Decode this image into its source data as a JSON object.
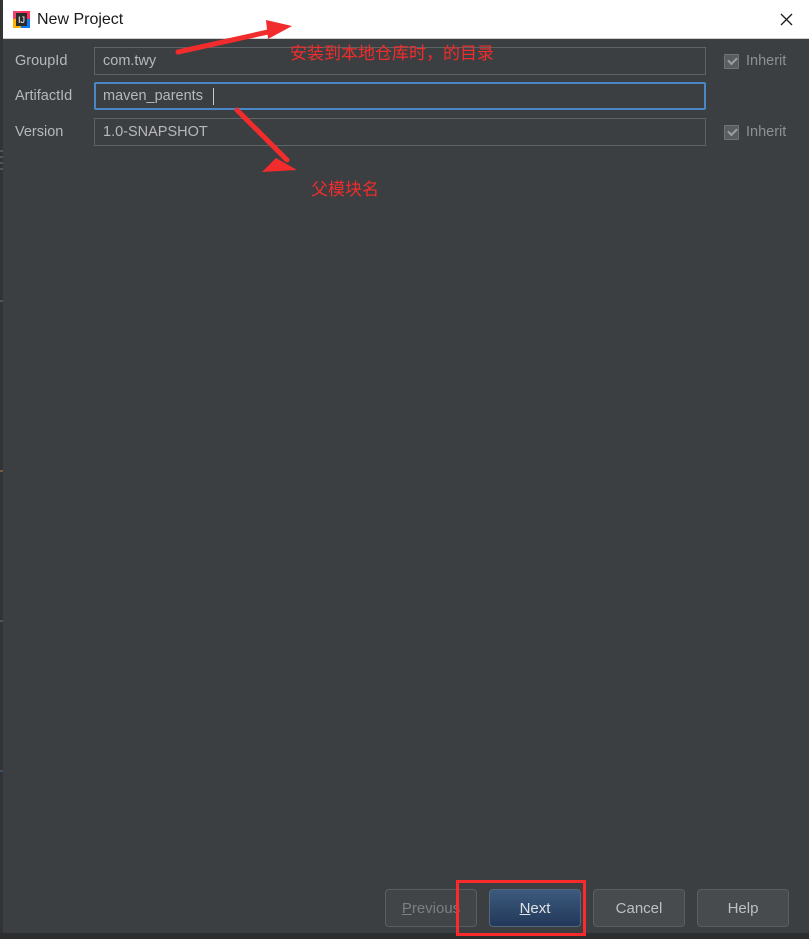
{
  "window": {
    "title": "New Project",
    "app_icon": "intellij-idea-icon",
    "close_icon": "close-icon"
  },
  "form": {
    "rows": [
      {
        "label": "GroupId",
        "value": "com.twy",
        "focused": false,
        "inherit": {
          "label": "Inherit",
          "checked": true,
          "enabled": false
        }
      },
      {
        "label": "ArtifactId",
        "value": "maven_parents",
        "focused": true,
        "inherit": null
      },
      {
        "label": "Version",
        "value": "1.0-SNAPSHOT",
        "focused": false,
        "inherit": {
          "label": "Inherit",
          "checked": true,
          "enabled": false
        }
      }
    ]
  },
  "annotations": {
    "color": "#f22c2c",
    "notes": [
      {
        "text": "安装到本地仓库时，的目录",
        "target": "groupid-field"
      },
      {
        "text": "父模块名",
        "target": "artifactid-field"
      }
    ],
    "highlight_box_target": "next-button"
  },
  "buttons": {
    "previous": {
      "label": "Previous",
      "mnemonic": "P",
      "rest": "revious",
      "enabled": false
    },
    "next": {
      "label": "Next",
      "mnemonic": "N",
      "rest": "ext",
      "primary": true,
      "enabled": true
    },
    "cancel": {
      "label": "Cancel",
      "enabled": true
    },
    "help": {
      "label": "Help",
      "enabled": true
    }
  },
  "colors": {
    "dialog_bg": "#3c3f41",
    "titlebar_bg": "#ffffff",
    "focus_border": "#4b87c8",
    "annotation_red": "#f22c2c",
    "primary_button": "#2f4a6b"
  }
}
